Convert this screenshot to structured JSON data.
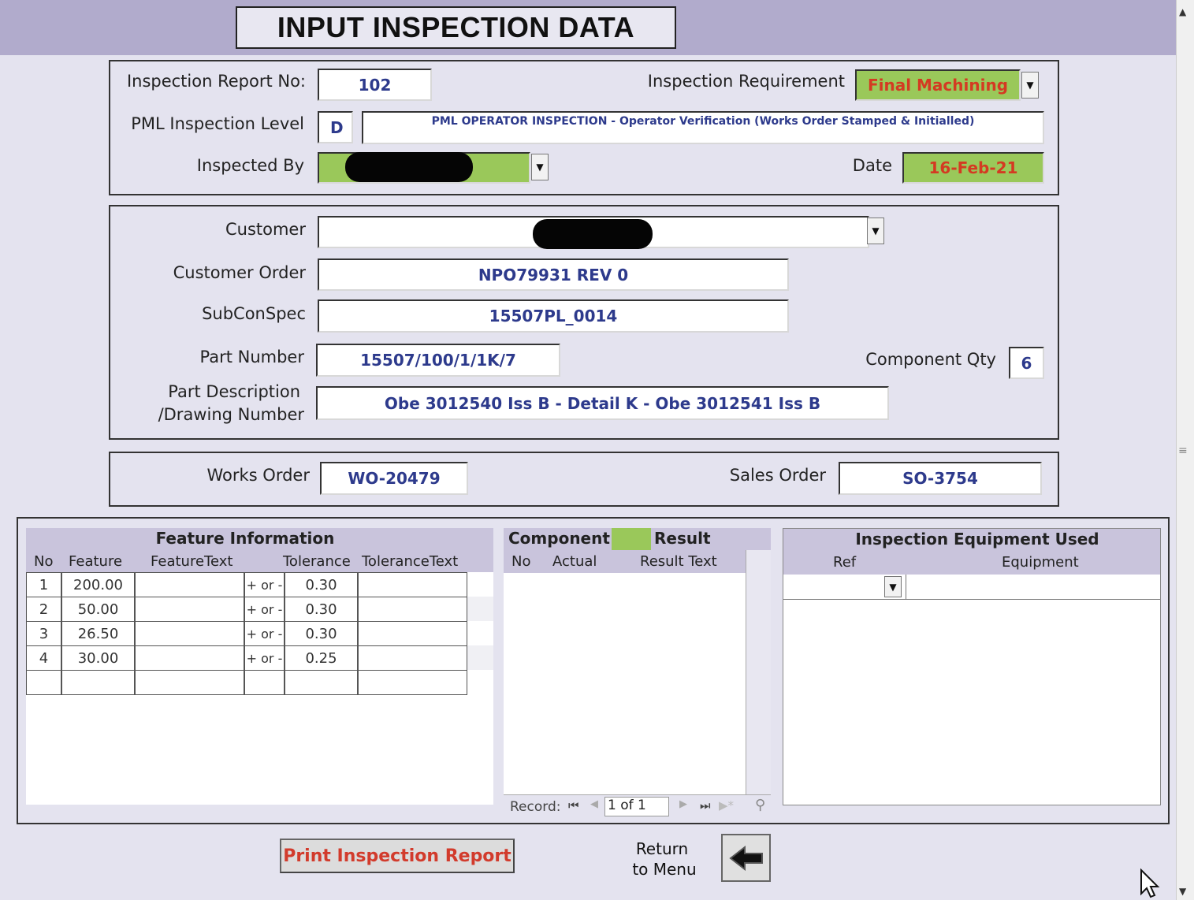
{
  "title": "INPUT INSPECTION DATA",
  "header": {
    "report_no_label": "Inspection Report No:",
    "report_no": "102",
    "requirement_label": "Inspection Requirement",
    "requirement": "Final Machining",
    "level_label": "PML Inspection Level",
    "level_code": "D",
    "level_text": "PML OPERATOR INSPECTION - Operator Verification (Works Order Stamped & Initialled)",
    "inspected_by_label": "Inspected By",
    "date_label": "Date",
    "date": "16-Feb-21"
  },
  "customer": {
    "customer_label": "Customer",
    "order_label": "Customer Order",
    "order": "NPO79931 REV 0",
    "subcon_label": "SubConSpec",
    "subcon": "15507PL_0014",
    "part_label": "Part Number",
    "part": "15507/100/1/1K/7",
    "qty_label": "Component Qty",
    "qty": "6",
    "desc_label_1": "Part Description",
    "desc_label_2": "/Drawing Number",
    "desc": "Obe 3012540 Iss B - Detail K - Obe 3012541 Iss B"
  },
  "orders": {
    "works_label": "Works Order",
    "works": "WO-20479",
    "sales_label": "Sales Order",
    "sales": "SO-3754"
  },
  "features": {
    "title": "Feature Information",
    "columns": [
      "No",
      "Feature",
      "FeatureText",
      "Tolerance",
      "ToleranceText"
    ],
    "rows": [
      {
        "no": "1",
        "feature": "200.00",
        "text": "",
        "pm": "+ or -",
        "tol": "0.30",
        "toltext": ""
      },
      {
        "no": "2",
        "feature": "50.00",
        "text": "",
        "pm": "+ or -",
        "tol": "0.30",
        "toltext": ""
      },
      {
        "no": "3",
        "feature": "26.50",
        "text": "",
        "pm": "+ or -",
        "tol": "0.30",
        "toltext": ""
      },
      {
        "no": "4",
        "feature": "30.00",
        "text": "",
        "pm": "+ or -",
        "tol": "0.25",
        "toltext": ""
      }
    ]
  },
  "component": {
    "title_left": "Component",
    "title_right": "Result",
    "columns": [
      "No",
      "Actual",
      "Result Text"
    ],
    "record_label": "Record:",
    "record_value": "1 of 1"
  },
  "equipment": {
    "title": "Inspection Equipment Used",
    "columns": [
      "Ref",
      "Equipment"
    ]
  },
  "buttons": {
    "print": "Print Inspection Report",
    "return_1": "Return",
    "return_2": "to Menu"
  }
}
